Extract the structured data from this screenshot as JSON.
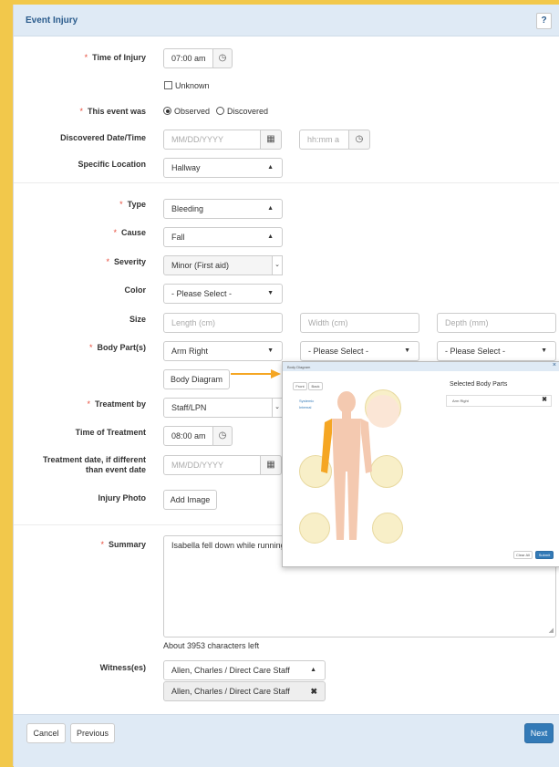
{
  "header": {
    "title": "Event Injury",
    "help": "?"
  },
  "form": {
    "time_of_injury": {
      "label": "Time of Injury",
      "value": "07:00 am",
      "unknown_label": "Unknown"
    },
    "event_was": {
      "label": "This event was",
      "options": [
        "Observed",
        "Discovered"
      ],
      "selected": "Observed"
    },
    "discovered": {
      "label": "Discovered Date/Time",
      "date_placeholder": "MM/DD/YYYY",
      "time_placeholder": "hh:mm a"
    },
    "location": {
      "label": "Specific Location",
      "value": "Hallway"
    },
    "type": {
      "label": "Type",
      "value": "Bleeding"
    },
    "cause": {
      "label": "Cause",
      "value": "Fall"
    },
    "severity": {
      "label": "Severity",
      "value": "Minor (First aid)"
    },
    "color": {
      "label": "Color",
      "value": "- Please Select -"
    },
    "size": {
      "label": "Size",
      "length_placeholder": "Length (cm)",
      "width_placeholder": "Width (cm)",
      "depth_placeholder": "Depth (mm)"
    },
    "body_parts": {
      "label": "Body Part(s)",
      "values": [
        "Arm Right",
        "- Please Select -",
        "- Please Select -"
      ],
      "diagram_button": "Body Diagram"
    },
    "treatment_by": {
      "label": "Treatment by",
      "value": "Staff/LPN"
    },
    "time_of_treatment": {
      "label": "Time of Treatment",
      "value": "08:00 am"
    },
    "treatment_date": {
      "label_line1": "Treatment date, if different",
      "label_line2": "than event date",
      "placeholder": "MM/DD/YYYY"
    },
    "injury_photo": {
      "label": "Injury Photo",
      "button": "Add Image"
    },
    "summary": {
      "label": "Summary",
      "value": "Isabella fell down while running",
      "chars_left": "About 3953 characters left"
    },
    "witness": {
      "label": "Witness(es)",
      "select_value": "Allen, Charles / Direct Care Staff",
      "selected_tag": "Allen, Charles / Direct Care Staff"
    }
  },
  "footer": {
    "cancel": "Cancel",
    "previous": "Previous",
    "next": "Next"
  },
  "popup": {
    "title": "Body Diagram",
    "tabs": [
      "Front",
      "Back"
    ],
    "links": [
      "Systemic",
      "Internal"
    ],
    "selected_heading": "Selected Body Parts",
    "selected_item": "Arm Right",
    "clear_all": "Clear All",
    "submit": "Submit"
  },
  "colors": {
    "accent": "#337ab7",
    "header_bg": "#dfeaf5",
    "required": "#e74c3c",
    "highlight": "#f5a623"
  }
}
